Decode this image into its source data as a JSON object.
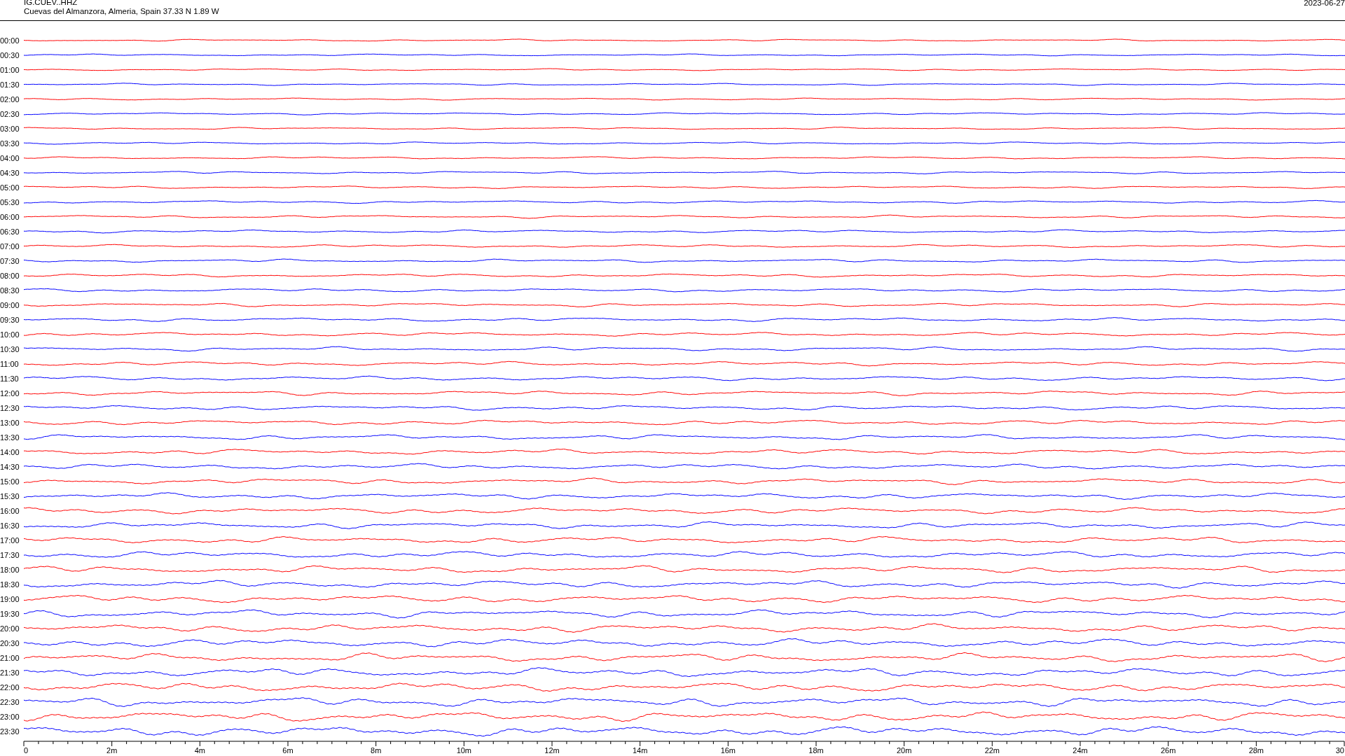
{
  "header": {
    "station": "IG.CUEV..HHZ",
    "location": "Cuevas del Almanzora, Almeria, Spain  37.33 N 1.89 W",
    "date": "2023-06-27"
  },
  "traces": [
    {
      "time": "00:00",
      "color": "#ff0000"
    },
    {
      "time": "00:30",
      "color": "#0000ff"
    },
    {
      "time": "01:00",
      "color": "#ff0000"
    },
    {
      "time": "01:30",
      "color": "#0000ff"
    },
    {
      "time": "02:00",
      "color": "#ff0000"
    },
    {
      "time": "02:30",
      "color": "#0000ff"
    },
    {
      "time": "03:00",
      "color": "#ff0000"
    },
    {
      "time": "03:30",
      "color": "#0000ff"
    },
    {
      "time": "04:00",
      "color": "#ff0000"
    },
    {
      "time": "04:30",
      "color": "#0000ff"
    },
    {
      "time": "05:00",
      "color": "#ff0000"
    },
    {
      "time": "05:30",
      "color": "#0000ff"
    },
    {
      "time": "06:00",
      "color": "#ff0000"
    },
    {
      "time": "06:30",
      "color": "#0000ff"
    },
    {
      "time": "07:00",
      "color": "#ff0000"
    },
    {
      "time": "07:30",
      "color": "#0000ff"
    },
    {
      "time": "08:00",
      "color": "#ff0000"
    },
    {
      "time": "08:30",
      "color": "#0000ff"
    },
    {
      "time": "09:00",
      "color": "#ff0000"
    },
    {
      "time": "09:30",
      "color": "#0000ff"
    },
    {
      "time": "10:00",
      "color": "#ff0000"
    },
    {
      "time": "10:30",
      "color": "#0000ff"
    },
    {
      "time": "11:00",
      "color": "#ff0000"
    },
    {
      "time": "11:30",
      "color": "#0000ff"
    },
    {
      "time": "12:00",
      "color": "#ff0000"
    },
    {
      "time": "12:30",
      "color": "#0000ff"
    },
    {
      "time": "13:00",
      "color": "#ff0000"
    },
    {
      "time": "13:30",
      "color": "#0000ff"
    },
    {
      "time": "14:00",
      "color": "#ff0000"
    },
    {
      "time": "14:30",
      "color": "#0000ff"
    },
    {
      "time": "15:00",
      "color": "#ff0000"
    },
    {
      "time": "15:30",
      "color": "#0000ff"
    },
    {
      "time": "16:00",
      "color": "#ff0000"
    },
    {
      "time": "16:30",
      "color": "#0000ff"
    },
    {
      "time": "17:00",
      "color": "#ff0000"
    },
    {
      "time": "17:30",
      "color": "#0000ff"
    },
    {
      "time": "18:00",
      "color": "#ff0000"
    },
    {
      "time": "18:30",
      "color": "#0000ff"
    },
    {
      "time": "19:00",
      "color": "#ff0000"
    },
    {
      "time": "19:30",
      "color": "#0000ff"
    },
    {
      "time": "20:00",
      "color": "#ff0000"
    },
    {
      "time": "20:30",
      "color": "#0000ff"
    },
    {
      "time": "21:00",
      "color": "#ff0000"
    },
    {
      "time": "21:30",
      "color": "#0000ff"
    },
    {
      "time": "22:00",
      "color": "#ff0000"
    },
    {
      "time": "22:30",
      "color": "#0000ff"
    },
    {
      "time": "23:00",
      "color": "#ff0000"
    },
    {
      "time": "23:30",
      "color": "#0000ff"
    }
  ],
  "x_axis": {
    "ticks": [
      "0",
      "2m",
      "4m",
      "6m",
      "8m",
      "10m",
      "12m",
      "14m",
      "16m",
      "18m",
      "20m",
      "22m",
      "24m",
      "26m",
      "28m",
      "30"
    ]
  }
}
